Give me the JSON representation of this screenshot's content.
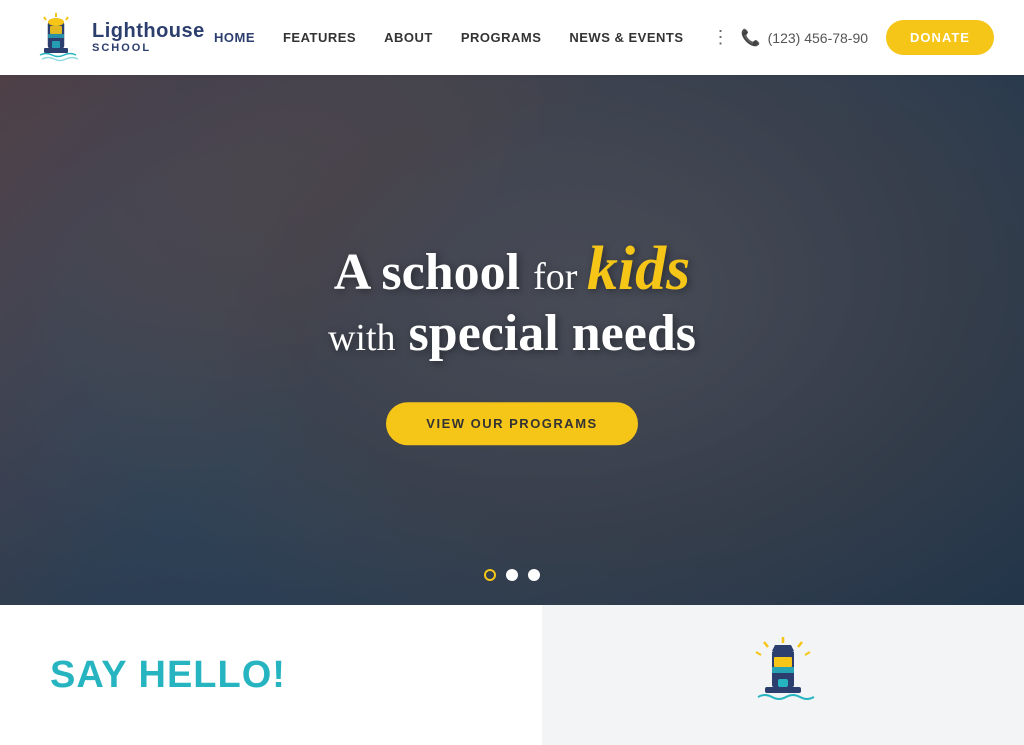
{
  "logo": {
    "title": "Lighthouse",
    "subtitle": "SCHOOL"
  },
  "nav": {
    "items": [
      {
        "label": "HOME",
        "active": true
      },
      {
        "label": "FEATURES",
        "active": false
      },
      {
        "label": "ABOUT",
        "active": false
      },
      {
        "label": "PROGRAMS",
        "active": false
      },
      {
        "label": "NEWS & EVENTS",
        "active": false
      }
    ]
  },
  "header": {
    "phone": "(123) 456-78-90",
    "donate_label": "DONATE"
  },
  "hero": {
    "line1_prefix": "A school",
    "line1_for": "for",
    "line1_kids": "kids",
    "line2_with": "with",
    "line2_suffix": "special needs",
    "cta_label": "VIEW OUR PROGRAMS",
    "dots": [
      {
        "active": true
      },
      {
        "active": false
      },
      {
        "active": false
      }
    ]
  },
  "bottom": {
    "say_hello": "SAY HELLO!"
  }
}
